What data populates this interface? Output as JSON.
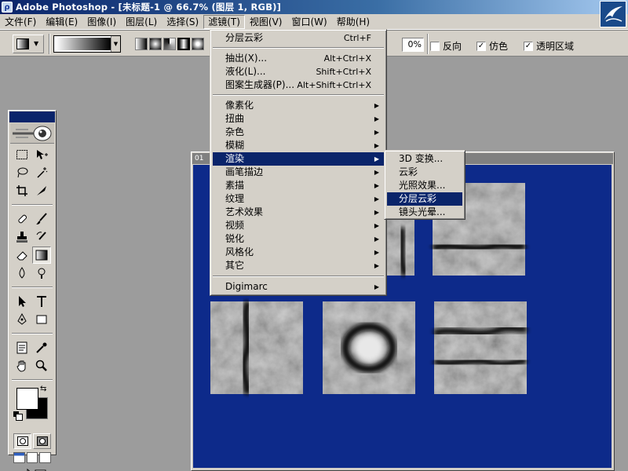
{
  "window": {
    "title": "Adobe Photoshop - [未标题-1 @ 66.7% (图层 1, RGB)]"
  },
  "menubar": {
    "items": [
      "文件(F)",
      "编辑(E)",
      "图像(I)",
      "图层(L)",
      "选择(S)",
      "滤镜(T)",
      "视图(V)",
      "窗口(W)",
      "帮助(H)"
    ],
    "active_index": 5
  },
  "options": {
    "opacity_value": "0%",
    "reverse_label": "反向",
    "reverse_checked": false,
    "dither_label": "仿色",
    "dither_checked": true,
    "transparency_label": "透明区域",
    "transparency_checked": true,
    "gradient_types": [
      "linear",
      "radial",
      "angle",
      "reflected",
      "diamond"
    ],
    "selected_gradient_type": "reflected"
  },
  "document": {
    "tab_label": "01"
  },
  "filter_menu": {
    "last_filter": {
      "label": "分层云彩",
      "shortcut": "Ctrl+F"
    },
    "extract": {
      "label": "抽出(X)...",
      "shortcut": "Alt+Ctrl+X"
    },
    "liquify": {
      "label": "液化(L)...",
      "shortcut": "Shift+Ctrl+X"
    },
    "pattern_maker": {
      "label": "图案生成器(P)...",
      "shortcut": "Alt+Shift+Ctrl+X"
    },
    "submenus": [
      "像素化",
      "扭曲",
      "杂色",
      "模糊",
      "渲染",
      "画笔描边",
      "素描",
      "纹理",
      "艺术效果",
      "视频",
      "锐化",
      "风格化",
      "其它"
    ],
    "highlighted_submenu": "渲染",
    "digimarc": "Digimarc"
  },
  "render_submenu": {
    "items": [
      "3D 变换...",
      "云彩",
      "光照效果...",
      "分层云彩",
      "镜头光晕..."
    ],
    "highlighted": "分层云彩"
  },
  "colors": {
    "foreground": "#ffffff",
    "background": "#000000",
    "canvas_bg": "#0d2a8a",
    "menu_highlight": "#0a246a"
  }
}
